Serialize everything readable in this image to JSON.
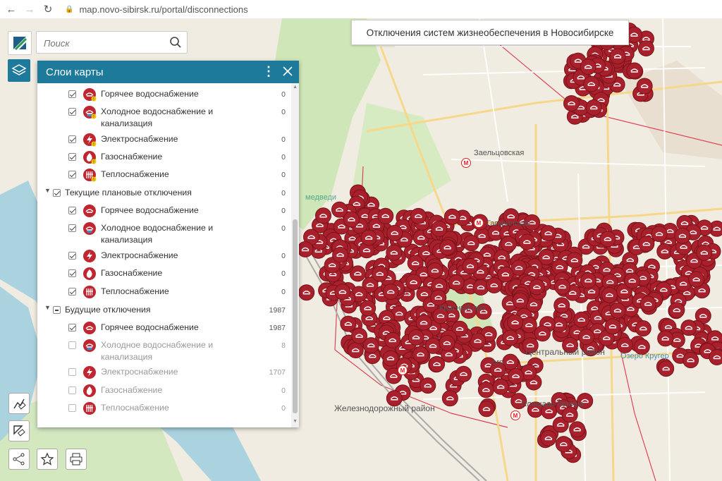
{
  "browser": {
    "url": "map.novo-sibirsk.ru/portal/disconnections"
  },
  "map": {
    "title": "Отключения систем жизнеобеспечения в Новосибирске",
    "labels": {
      "zaeltsovskaya": "Заельцовская",
      "gagarinskaya": "Гагаринская",
      "medvedi": "медведи",
      "krasny_prospekt": "Красный про",
      "tsentralny": "Центральный район",
      "ozero_kruger": "Озеро Кругер",
      "ploshchad_lenina": "Площадь Ленина",
      "zheleznodorozhny": "Железнодорожный район",
      "ogo": "ого"
    },
    "metro_symbol": "M",
    "marker_color": "#a8202c"
  },
  "search": {
    "placeholder": "Поиск"
  },
  "layers_panel": {
    "title": "Слои карты",
    "items": [
      {
        "label": "Горячее водоснабжение",
        "count": "0",
        "icon": "hot-water-icon"
      },
      {
        "label": "Холодное водоснабжение и",
        "label2": "канализация",
        "count": "0",
        "icon": "cold-water-icon"
      },
      {
        "label": "Электроснабжение",
        "count": "0",
        "icon": "electricity-icon"
      },
      {
        "label": "Газоснабжение",
        "count": "0",
        "icon": "gas-icon"
      },
      {
        "label": "Теплоснабжение",
        "count": "0",
        "icon": "heating-icon"
      },
      {
        "label": "Текущие плановые отключения",
        "count": "0"
      },
      {
        "label": "Горячее водоснабжение",
        "count": "0"
      },
      {
        "label": "Холодное водоснабжение и",
        "label2": "канализация",
        "count": "0"
      },
      {
        "label": "Электроснабжение",
        "count": "0"
      },
      {
        "label": "Газоснабжение",
        "count": "0"
      },
      {
        "label": "Теплоснабжение",
        "count": "0"
      },
      {
        "label": "Будущие отключения",
        "count": "1987"
      },
      {
        "label": "Горячее водоснабжение",
        "count": "1987"
      },
      {
        "label": "Холодное водоснабжение и",
        "label2": "канализация",
        "count": "8"
      },
      {
        "label": "Электроснабжение",
        "count": "1707"
      },
      {
        "label": "Газоснабжение",
        "count": "0"
      },
      {
        "label": "Теплоснабжение",
        "count": "0"
      }
    ]
  }
}
